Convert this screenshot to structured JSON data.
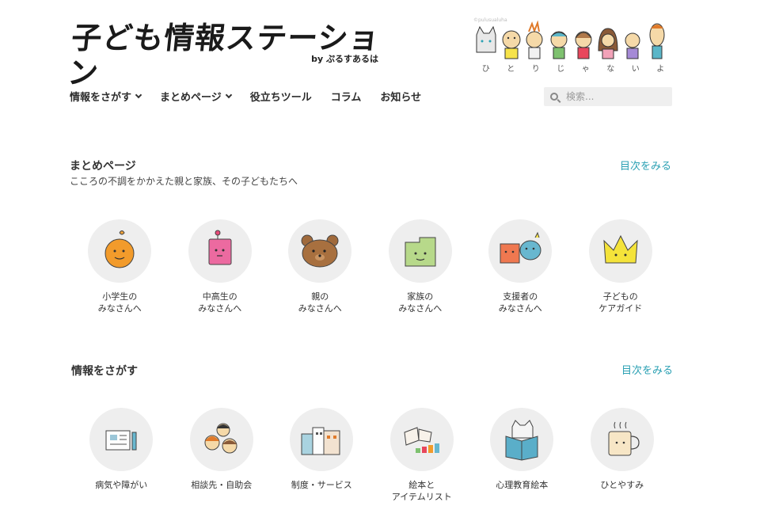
{
  "header": {
    "logo_title": "子ども情報ステーション",
    "logo_by": "by ぷるすあるは",
    "mascot_credit": "©pulusualuha",
    "mascot_letters": [
      "ひ",
      "と",
      "り",
      "じ",
      "ゃ",
      "な",
      "い",
      "よ"
    ]
  },
  "nav": {
    "items": [
      {
        "label": "情報をさがす",
        "has_dropdown": true
      },
      {
        "label": "まとめページ",
        "has_dropdown": true
      },
      {
        "label": "役立ちツール",
        "has_dropdown": false
      },
      {
        "label": "コラム",
        "has_dropdown": false
      },
      {
        "label": "お知らせ",
        "has_dropdown": false
      }
    ]
  },
  "search": {
    "placeholder": "検索..."
  },
  "matome": {
    "title": "まとめページ",
    "subtitle": "こころの不調をかかえた親と家族、その子どもたちへ",
    "toc_label": "目次をみる",
    "cards": [
      {
        "label": "小学生の\nみなさんへ",
        "icon": "orange-character-icon"
      },
      {
        "label": "中高生の\nみなさんへ",
        "icon": "pink-character-icon"
      },
      {
        "label": "親の\nみなさんへ",
        "icon": "bear-character-icon"
      },
      {
        "label": "家族の\nみなさんへ",
        "icon": "green-house-character-icon"
      },
      {
        "label": "支援者の\nみなさんへ",
        "icon": "supporter-characters-icon"
      },
      {
        "label": "子どもの\nケアガイド",
        "icon": "crown-character-icon"
      }
    ]
  },
  "info": {
    "title": "情報をさがす",
    "toc_label": "目次をみる",
    "cards": [
      {
        "label": "病気や障がい",
        "icon": "notebook-icon"
      },
      {
        "label": "相談先・自助会",
        "icon": "people-group-icon"
      },
      {
        "label": "制度・サービス",
        "icon": "buildings-icon"
      },
      {
        "label": "絵本と\nアイテムリスト",
        "icon": "picture-books-icon"
      },
      {
        "label": "心理教育絵本",
        "icon": "reading-book-icon"
      },
      {
        "label": "ひとやすみ",
        "icon": "coffee-cup-icon"
      }
    ]
  },
  "colors": {
    "accent": "#2aa0b3",
    "circle_bg": "#eeeeee",
    "search_bg": "#efefef"
  }
}
